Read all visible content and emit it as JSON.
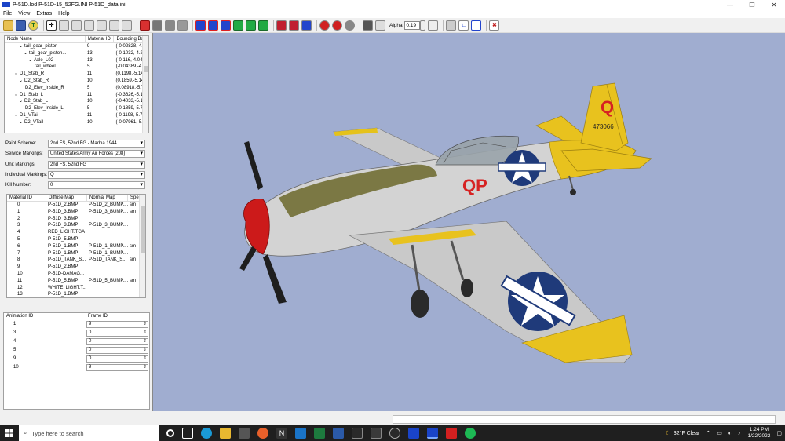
{
  "window": {
    "title": "P-51D.lod  P-51D-15_52FG.INI  P-51D_data.ini"
  },
  "menu": [
    "File",
    "View",
    "Extras",
    "Help"
  ],
  "toolbar": {
    "alpha_label": "Alpha:",
    "alpha_value": "0.19"
  },
  "node_tree": {
    "headers": [
      "Node Name",
      "Material ID",
      "Bounding Bo"
    ],
    "rows": [
      {
        "indent": 3,
        "tog": "⌄",
        "name": "tail_gear_piston",
        "mat": "9",
        "bb": "(-0.02828,-4."
      },
      {
        "indent": 4,
        "tog": "⌄",
        "name": "tail_gear_piston...",
        "mat": "13",
        "bb": "(-0.1032,-4.2"
      },
      {
        "indent": 5,
        "tog": "⌄",
        "name": "Axle_L02",
        "mat": "13",
        "bb": "(-0.116,-4.04"
      },
      {
        "indent": 6,
        "tog": "",
        "name": "tail_wheel",
        "mat": "5",
        "bb": "(-0.04389,-4."
      },
      {
        "indent": 2,
        "tog": "⌄",
        "name": "D1_Stab_R",
        "mat": "11",
        "bb": "(0.1198,-5.14"
      },
      {
        "indent": 3,
        "tog": "⌄",
        "name": "D2_Stab_R",
        "mat": "10",
        "bb": "(0.1859,-5.14"
      },
      {
        "indent": 4,
        "tog": "",
        "name": "D2_Elev_Inside_R",
        "mat": "5",
        "bb": "(0.08918,-5.7"
      },
      {
        "indent": 2,
        "tog": "⌄",
        "name": "D1_Stab_L",
        "mat": "11",
        "bb": "(-0.3626,-5.1"
      },
      {
        "indent": 3,
        "tog": "⌄",
        "name": "D2_Stab_L",
        "mat": "10",
        "bb": "(-0.4033,-5.1"
      },
      {
        "indent": 4,
        "tog": "",
        "name": "D2_Elev_Inside_L",
        "mat": "5",
        "bb": "(-0.1859,-5.7"
      },
      {
        "indent": 2,
        "tog": "⌄",
        "name": "D1_VTail",
        "mat": "11",
        "bb": "(-0.1198,-5.7"
      },
      {
        "indent": 3,
        "tog": "⌄",
        "name": "D2_VTail",
        "mat": "10",
        "bb": "(-0.07961,-5."
      }
    ]
  },
  "properties": [
    {
      "label": "Paint Scheme:",
      "value": "2nd FS, 52nd FG - Madna 1944"
    },
    {
      "label": "Service Markings:",
      "value": "United States Army Air Forces [208]"
    },
    {
      "label": "Unit Markings:",
      "value": "2nd FS, 52nd FG"
    },
    {
      "label": "Individual Markings:",
      "value": "Q"
    },
    {
      "label": "Kill Number:",
      "value": "0"
    }
  ],
  "materials": {
    "headers": [
      "Material ID",
      "Diffuse Map",
      "Normal Map",
      "Spe"
    ],
    "rows": [
      [
        "0",
        "P-51D_2.BMP",
        "P-51D_2_BUMP....",
        "sm"
      ],
      [
        "1",
        "P-51D_3.BMP",
        "P-51D_3_BUMP....",
        "sm"
      ],
      [
        "2",
        "P-51D_3.BMP",
        "",
        ""
      ],
      [
        "3",
        "P-51D_3.BMP",
        "P-51D_3_BUMP....",
        ""
      ],
      [
        "4",
        "RED_LIGHT.TGA",
        "",
        ""
      ],
      [
        "5",
        "P-51D_5.BMP",
        "",
        ""
      ],
      [
        "6",
        "P-51D_1.BMP",
        "P-51D_1_BUMP....",
        "sm"
      ],
      [
        "7",
        "P-51D_1.BMP",
        "P-51D_1_BUMP....",
        ""
      ],
      [
        "8",
        "P-51D_TANK_S...",
        "P-51D_TANK_S...",
        "sm"
      ],
      [
        "9",
        "P-51D_2.BMP",
        "",
        ""
      ],
      [
        "10",
        "P-51D-DAMAG...",
        "",
        ""
      ],
      [
        "11",
        "P-51D_5.BMP",
        "P-51D_5_BUMP....",
        "sm"
      ],
      [
        "12",
        "WHITE_LIGHT.T...",
        "",
        ""
      ],
      [
        "13",
        "P-51D_1.BMP",
        "",
        ""
      ]
    ]
  },
  "animations": {
    "headers": [
      "Animation ID",
      "Frame ID"
    ],
    "rows": [
      [
        "1",
        "9"
      ],
      [
        "3",
        "0"
      ],
      [
        "4",
        "0"
      ],
      [
        "5",
        "0"
      ],
      [
        "9",
        "0"
      ],
      [
        "10",
        "9"
      ]
    ]
  },
  "aircraft": {
    "fuselage_code": "QP",
    "tail_letter": "Q",
    "serial": "473066"
  },
  "taskbar": {
    "search_placeholder": "Type here to search",
    "weather": "32°F  Clear",
    "time": "1:24 PM",
    "date": "1/22/2022"
  }
}
